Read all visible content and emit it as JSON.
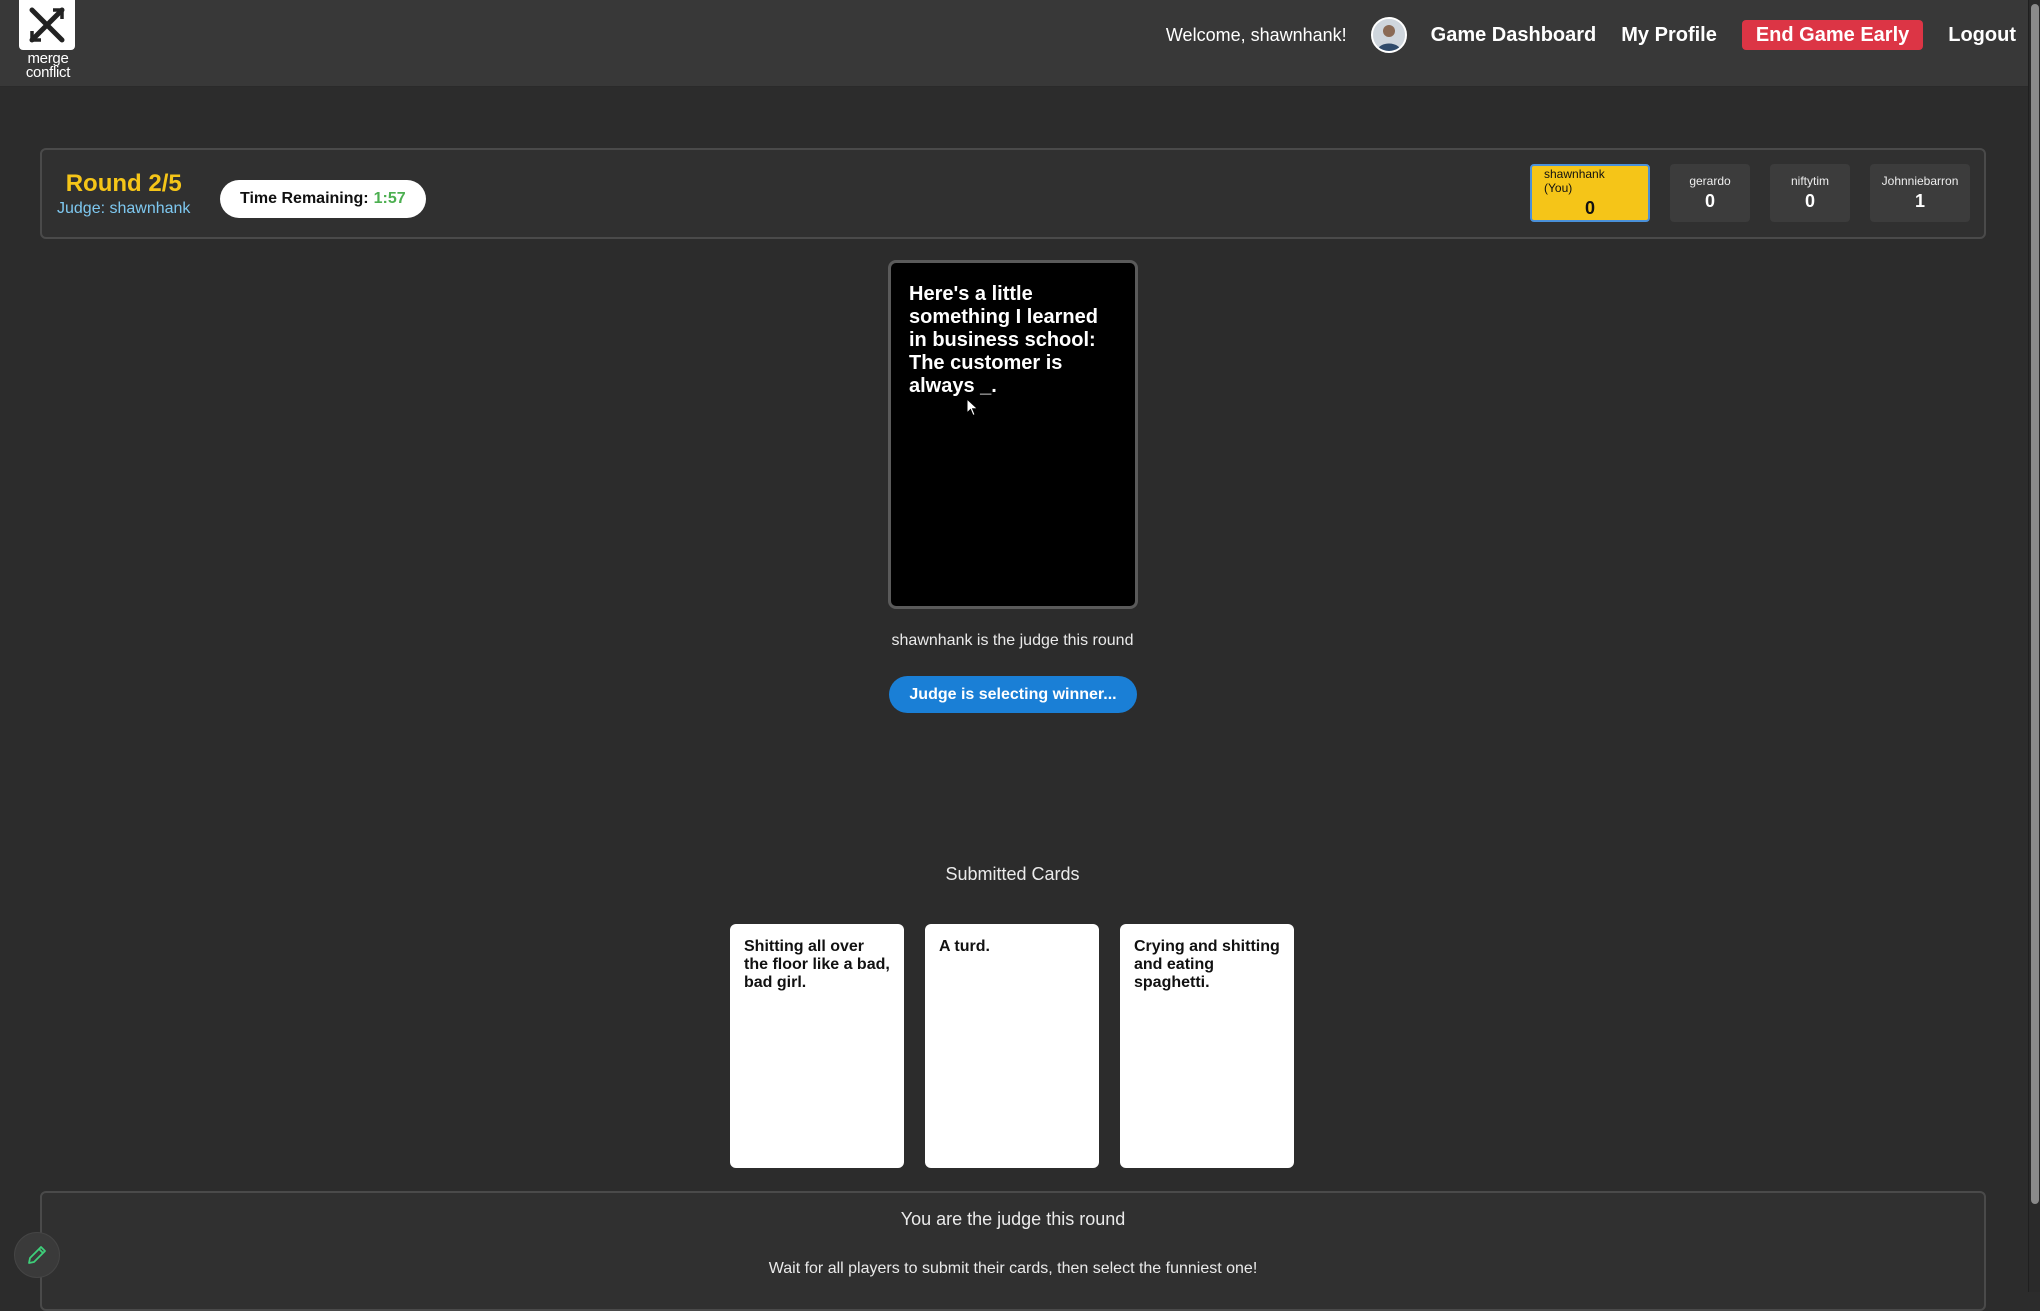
{
  "app": {
    "logo_text_line1": "merge",
    "logo_text_line2": "conflict",
    "logo_icon": "x-arrows-icon"
  },
  "nav": {
    "welcome": "Welcome, shawnhank!",
    "avatar_icon": "user-avatar",
    "dashboard": "Game Dashboard",
    "profile": "My Profile",
    "end_game": "End Game Early",
    "logout": "Logout"
  },
  "status": {
    "round": "Round 2/5",
    "judge": "Judge: shawnhank",
    "timer_label": "Time Remaining:",
    "timer_value": "1:57",
    "players": [
      {
        "name": "shawnhank (You)",
        "score": "0",
        "is_you": true
      },
      {
        "name": "gerardo",
        "score": "0",
        "is_you": false
      },
      {
        "name": "niftytim",
        "score": "0",
        "is_you": false
      },
      {
        "name": "Johnniebarron",
        "score": "1",
        "is_you": false
      }
    ]
  },
  "black_card": {
    "text": "Here's a little something I learned in business school: The customer is always _."
  },
  "round_info": {
    "judge_text": "shawnhank is the judge this round",
    "selecting_button": "Judge is selecting winner..."
  },
  "submitted": {
    "title": "Submitted Cards",
    "cards": [
      "Shitting all over the floor like a bad, bad girl.",
      "A turd.",
      "Crying and shitting and eating spaghetti."
    ]
  },
  "judge_panel": {
    "title": "You are the judge this round",
    "subtitle": "Wait for all players to submit their cards, then select the funniest one!"
  },
  "colors": {
    "accent_yellow": "#f5c518",
    "danger": "#dc3545",
    "primary_blue": "#1a7fd6",
    "timer_green": "#4caf50",
    "judge_blue": "#7ec8f0"
  }
}
